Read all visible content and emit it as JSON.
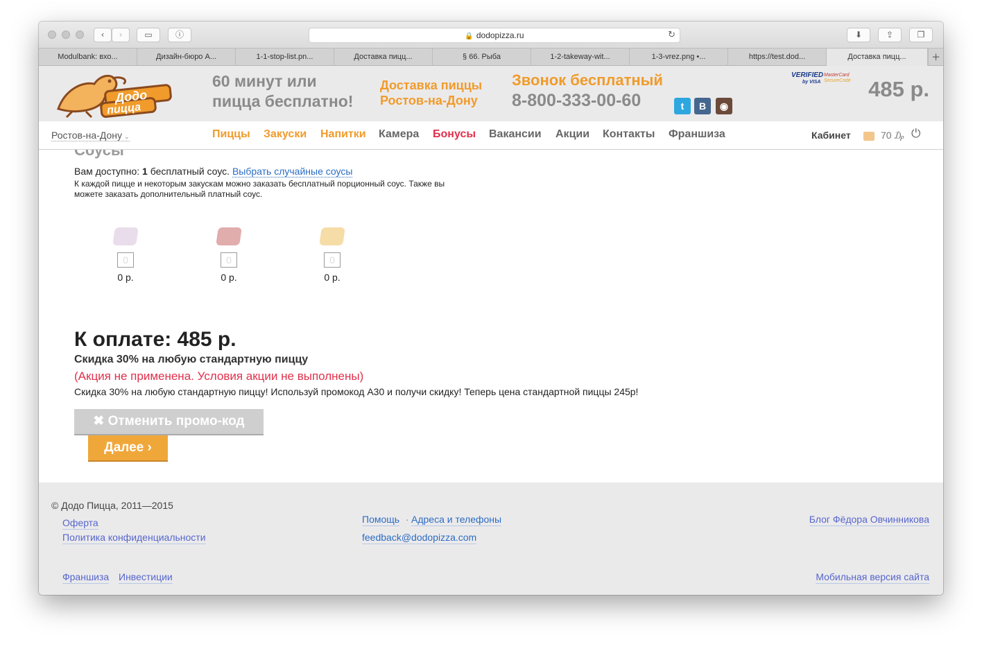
{
  "browser": {
    "url": "dodopizza.ru",
    "tabs": [
      {
        "label": "Modulbank: вхо..."
      },
      {
        "label": "Дизайн-бюро А..."
      },
      {
        "label": "1-1-stop-list.pn..."
      },
      {
        "label": "Доставка пицц..."
      },
      {
        "label": "§ 66. Рыба"
      },
      {
        "label": "1-2-takeway-wit..."
      },
      {
        "label": "1-3-vrez.png •..."
      },
      {
        "label": "https://test.dod..."
      },
      {
        "label": "Доставка пицц..."
      }
    ]
  },
  "header": {
    "logo_top": "Додо",
    "logo_bottom": "пицца",
    "slogan_line1": "60 минут или",
    "slogan_line2": "пицца бесплатно!",
    "delivery_line1": "Доставка пиццы",
    "delivery_line2": "Ростов-на-Дону",
    "call_label": "Звонок бесплатный",
    "phone": "8-800-333-00-60",
    "verified_text": "VERIFIED",
    "verified_sub": "by VISA",
    "mastercard_line1": "MasterCard",
    "mastercard_line2": "SecureCode",
    "cart_total": "485 р.",
    "social": [
      {
        "glyph": "t",
        "color": "#2ea7e0"
      },
      {
        "glyph": "B",
        "color": "#45668e"
      },
      {
        "glyph": "◉",
        "color": "#6b4a3a"
      }
    ]
  },
  "nav": {
    "city": "Ростов-на-Дону",
    "items": [
      {
        "label": "Пиццы",
        "color": "#f09b2b"
      },
      {
        "label": "Закуски",
        "color": "#f09b2b"
      },
      {
        "label": "Напитки",
        "color": "#f09b2b"
      },
      {
        "label": "Камера",
        "color": "#666666"
      },
      {
        "label": "Бонусы",
        "color": "#e0304b"
      },
      {
        "label": "Вакансии",
        "color": "#666666"
      },
      {
        "label": "Акции",
        "color": "#666666"
      },
      {
        "label": "Контакты",
        "color": "#666666"
      },
      {
        "label": "Франшиза",
        "color": "#666666"
      }
    ],
    "cabinet": "Кабинет",
    "bonus_balance": "70 ₯"
  },
  "sauces": {
    "title": "Соусы",
    "available_prefix": "Вам доступно:",
    "available_count": "1",
    "available_suffix": "бесплатный соус.",
    "random_link": "Выбрать случайные соусы",
    "description": "К каждой пицце и некоторым закускам можно заказать бесплатный порционный соус. Также вы можете заказать дополнительный платный соус.",
    "items": [
      {
        "qty": "0",
        "price": "0 р.",
        "color": "#d9c3dc"
      },
      {
        "qty": "0",
        "price": "0 р.",
        "color": "#c96a6a"
      },
      {
        "qty": "0",
        "price": "0 р.",
        "color": "#f0c060"
      }
    ]
  },
  "payment": {
    "total": "К оплате: 485 р.",
    "promo_name": "Скидка 30% на любую стандартную пиццу",
    "promo_warning": "(Акция не применена. Условия акции не выполнены)",
    "promo_description": "Скидка 30% на любую стандартную пиццу! Используй промокод А30 и получи скидку! Теперь цена стандартной пиццы 245р!",
    "cancel_button": "✖ Отменить промо-код",
    "next_button": "Далее ›"
  },
  "footer": {
    "copyright": "© Додо Пицца, 2011—2015",
    "offer": "Оферта",
    "privacy": "Политика конфиденциальности",
    "help": "Помощь",
    "dot": "·",
    "addresses": "Адреса и телефоны",
    "email": "feedback@dodopizza.com",
    "blog": "Блог Фёдора Овчинникова",
    "franchise": "Франшиза",
    "investments": "Инвестиции",
    "mobile": "Мобильная версия сайта"
  }
}
